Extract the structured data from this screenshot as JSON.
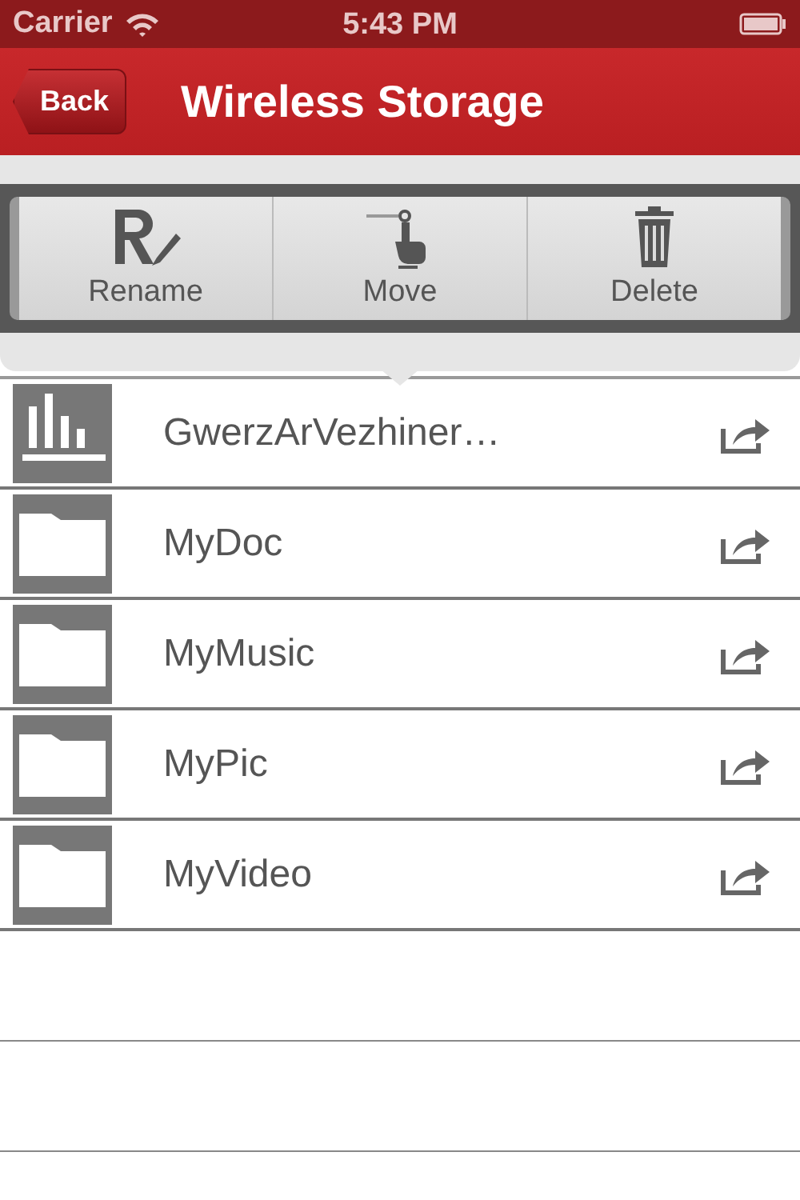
{
  "status_bar": {
    "carrier": "Carrier",
    "time": "5:43 PM"
  },
  "nav_bar": {
    "back": "Back",
    "title": "Wireless Storage"
  },
  "action_menu": [
    {
      "label": "Rename",
      "kind": "rename"
    },
    {
      "label": "Move",
      "kind": "move"
    },
    {
      "label": "Delete",
      "kind": "delete"
    }
  ],
  "files": [
    {
      "name": "GwerzArVezhiner…",
      "kind": "audio"
    },
    {
      "name": "MyDoc",
      "kind": "folder"
    },
    {
      "name": "MyMusic",
      "kind": "folder"
    },
    {
      "name": "MyPic",
      "kind": "folder"
    },
    {
      "name": "MyVideo",
      "kind": "folder"
    }
  ]
}
